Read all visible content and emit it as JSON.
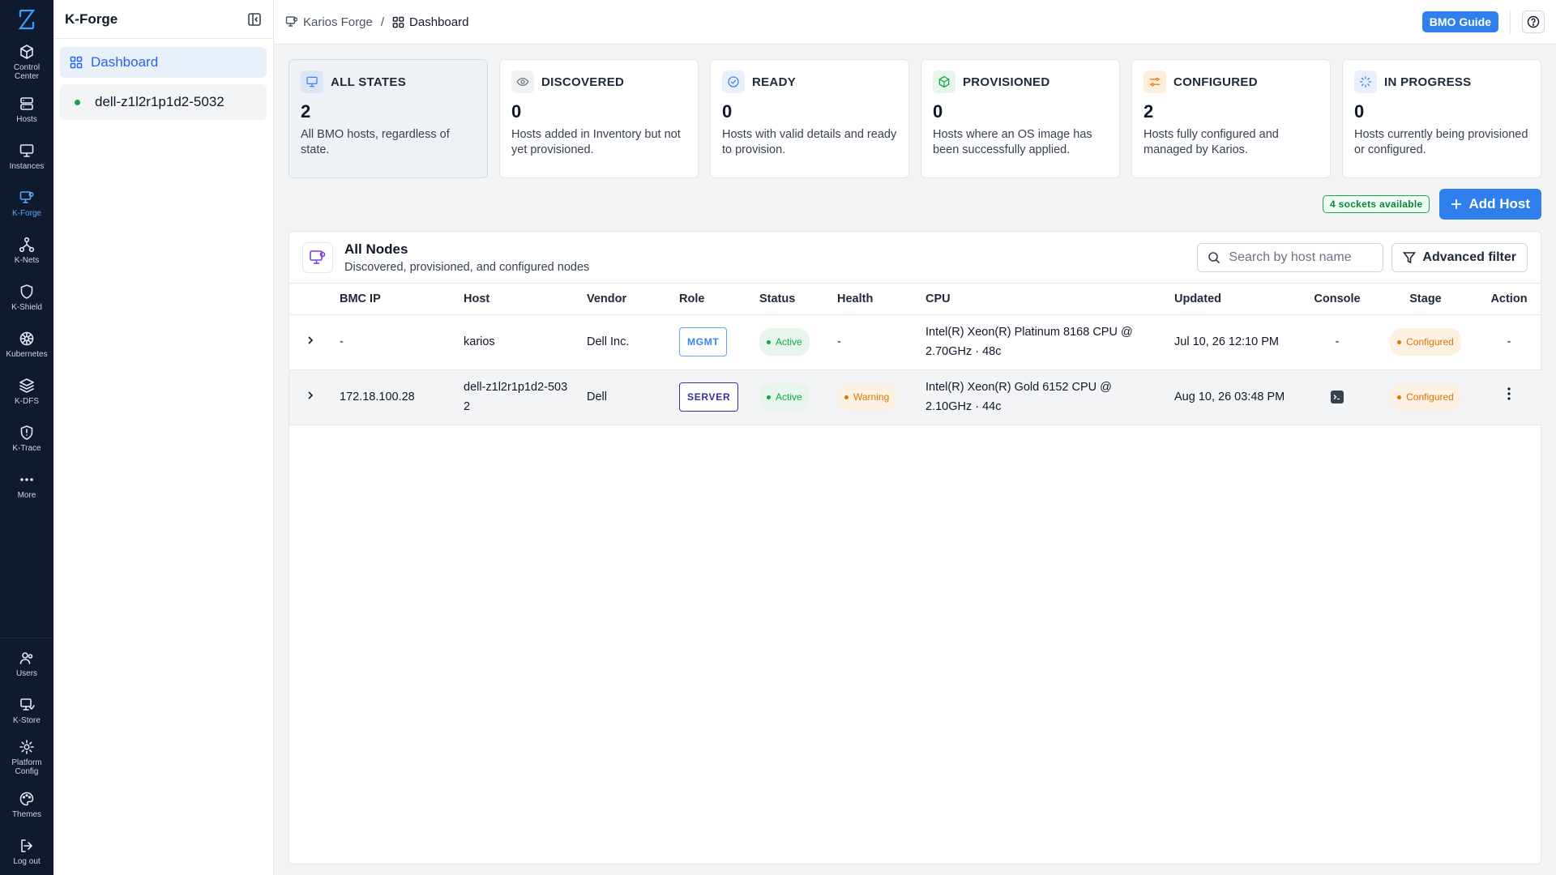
{
  "rail": {
    "top_items": [
      {
        "label": "Control\nCenter",
        "icon": "cube-icon"
      },
      {
        "label": "Hosts",
        "icon": "server-icon"
      },
      {
        "label": "Instances",
        "icon": "monitor-icon"
      },
      {
        "label": "K-Forge",
        "icon": "forge-icon",
        "active": true
      },
      {
        "label": "K-Nets",
        "icon": "network-icon"
      },
      {
        "label": "K-Shield",
        "icon": "shield-icon"
      },
      {
        "label": "Kubernetes",
        "icon": "helm-icon"
      },
      {
        "label": "K-DFS",
        "icon": "layers-icon"
      },
      {
        "label": "K-Trace",
        "icon": "trace-shield-icon"
      },
      {
        "label": "More",
        "icon": "more-icon"
      }
    ],
    "bottom_items": [
      {
        "label": "Users",
        "icon": "users-icon"
      },
      {
        "label": "K-Store",
        "icon": "store-icon"
      },
      {
        "label": "Platform\nConfig",
        "icon": "gear-icon"
      },
      {
        "label": "Themes",
        "icon": "palette-icon"
      },
      {
        "label": "Log out",
        "icon": "logout-icon"
      }
    ]
  },
  "sidebar": {
    "title": "K-Forge",
    "items": [
      {
        "label": "Dashboard"
      },
      {
        "label": "dell-z1l2r1p1d2-5032"
      }
    ]
  },
  "topbar": {
    "breadcrumb": [
      "Karios Forge",
      "Dashboard"
    ],
    "separator": "/",
    "guide_label": "BMO Guide"
  },
  "cards": [
    {
      "title": "ALL STATES",
      "count": "2",
      "desc": "All BMO hosts, regardless of state.",
      "icon": "monitor-icon",
      "color": "#3b82f6",
      "bg": "#dbe7f7"
    },
    {
      "title": "DISCOVERED",
      "count": "0",
      "desc": "Hosts added in Inventory but not yet provisioned.",
      "icon": "eye-icon",
      "color": "#6b7280",
      "bg": "#f1f2f4"
    },
    {
      "title": "READY",
      "count": "0",
      "desc": "Hosts with valid details and ready to provision.",
      "icon": "check-circle-icon",
      "color": "#3b82f6",
      "bg": "#e8f0fb"
    },
    {
      "title": "PROVISIONED",
      "count": "0",
      "desc": "Hosts where an OS image has been successfully applied.",
      "icon": "box-icon",
      "color": "#16a34a",
      "bg": "#e6f6ea"
    },
    {
      "title": "CONFIGURED",
      "count": "2",
      "desc": "Hosts fully configured and managed by Karios.",
      "icon": "sliders-icon",
      "color": "#ea7a1a",
      "bg": "#fdeedd"
    },
    {
      "title": "IN PROGRESS",
      "count": "0",
      "desc": "Hosts currently being provisioned or configured.",
      "icon": "loader-icon",
      "color": "#3b82f6",
      "bg": "#e8f0fb"
    }
  ],
  "actions": {
    "sockets": "4 sockets available",
    "add_host": "Add Host"
  },
  "panel": {
    "title": "All Nodes",
    "subtitle": "Discovered, provisioned, and configured nodes",
    "search_placeholder": "Search by host name",
    "advanced_filter": "Advanced filter"
  },
  "table": {
    "columns": [
      "BMC IP",
      "Host",
      "Vendor",
      "Role",
      "Status",
      "Health",
      "CPU",
      "Updated",
      "Console",
      "Stage",
      "Action"
    ],
    "rows": [
      {
        "bmc_ip": "-",
        "host": "karios",
        "vendor": "Dell Inc.",
        "role": "MGMT",
        "status": "Active",
        "health": "-",
        "cpu": "Intel(R) Xeon(R) Platinum 8168 CPU @ 2.70GHz · 48c",
        "updated": "Jul 10, 26 12:10 PM",
        "console": "-",
        "stage": "Configured",
        "action": "-"
      },
      {
        "bmc_ip": "172.18.100.28",
        "host": "dell-z1l2r1p1d2-5032",
        "vendor": "Dell",
        "role": "SERVER",
        "status": "Active",
        "health": "Warning",
        "cpu": "Intel(R) Xeon(R) Gold 6152 CPU @ 2.10GHz · 44c",
        "updated": "Aug 10, 26 03:48 PM",
        "console": "terminal-icon",
        "stage": "Configured",
        "action": "kebab-menu-icon"
      }
    ]
  }
}
